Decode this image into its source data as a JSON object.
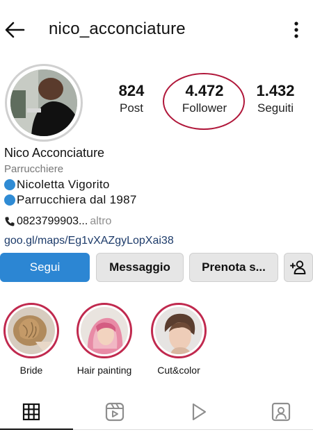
{
  "header": {
    "username": "nico_acconciature",
    "back_icon": "back-arrow-icon",
    "more_icon": "more-vertical-icon"
  },
  "stats": {
    "posts": {
      "value": "824",
      "label": "Post"
    },
    "followers": {
      "value": "4.472",
      "label": "Follower"
    },
    "following": {
      "value": "1.432",
      "label": "Seguiti"
    }
  },
  "bio": {
    "name": "Nico Acconciature",
    "category": "Parrucchiere",
    "line1": "Nicoletta Vigorito",
    "line2": "Parrucchiera dal 1987",
    "phone": "0823799903...",
    "more_label": "altro",
    "link": "goo.gl/maps/Eg1vXAZgyLopXai38"
  },
  "actions": {
    "follow": "Segui",
    "message": "Messaggio",
    "book": "Prenota s..."
  },
  "highlights": [
    {
      "label": "Bride"
    },
    {
      "label": "Hair painting"
    },
    {
      "label": "Cut&color"
    }
  ],
  "tabs": [
    "grid-icon",
    "reels-icon",
    "video-play-icon",
    "tagged-icon"
  ],
  "colors": {
    "follow_button": "#2c86d3",
    "highlight_ring": "#c0294e",
    "annotation_ellipse": "#b0173a",
    "bio_dot": "#2f8bd4",
    "link": "#1d3b6a"
  }
}
